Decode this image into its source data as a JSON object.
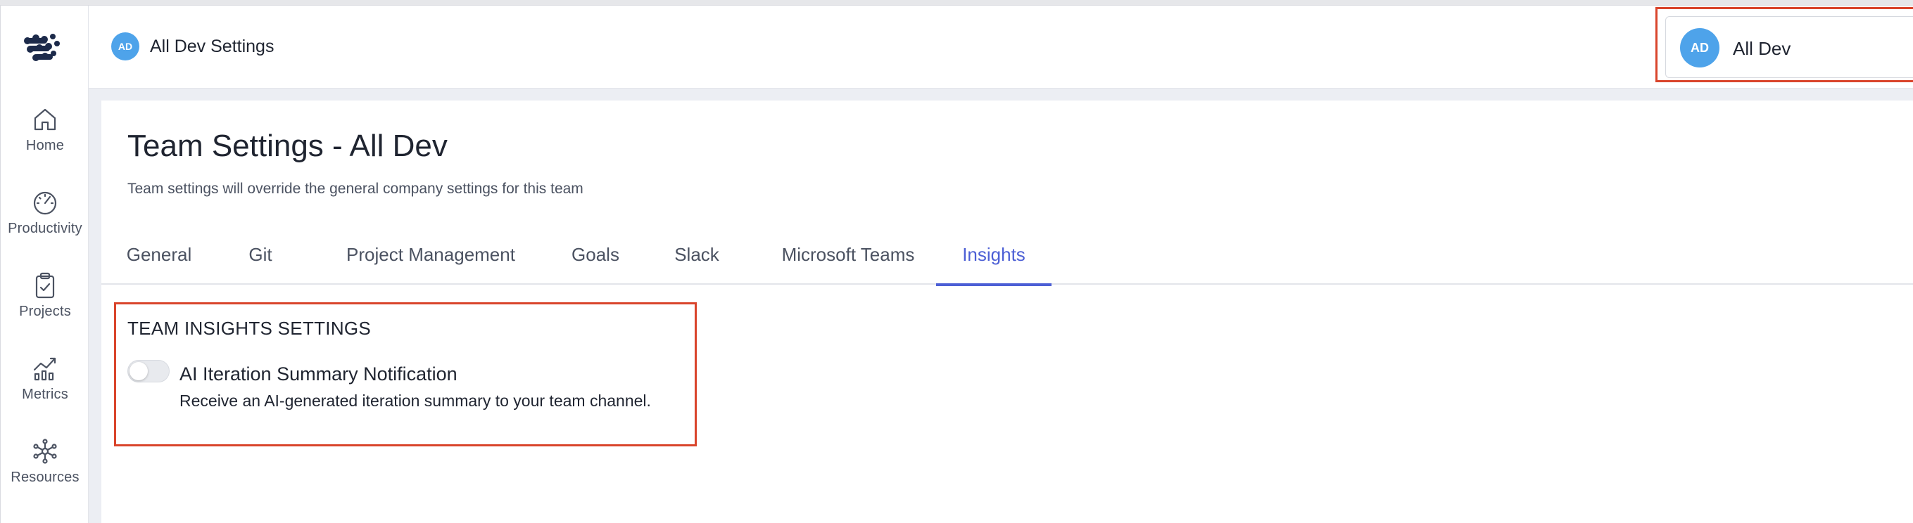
{
  "sidebar": {
    "items": [
      {
        "label": "Home",
        "icon": "home-icon"
      },
      {
        "label": "Productivity",
        "icon": "gauge-icon"
      },
      {
        "label": "Projects",
        "icon": "clipboard-icon"
      },
      {
        "label": "Metrics",
        "icon": "chart-icon"
      },
      {
        "label": "Resources",
        "icon": "network-icon"
      }
    ]
  },
  "header": {
    "avatar_initials": "AD",
    "title": "All Dev Settings",
    "team_selector": {
      "avatar_initials": "AD",
      "value": "All Dev"
    }
  },
  "main": {
    "title": "Team Settings - All Dev",
    "subtitle": "Team settings will override the general company settings for this team",
    "tabs": [
      {
        "label": "General"
      },
      {
        "label": "Git"
      },
      {
        "label": "Project Management"
      },
      {
        "label": "Goals"
      },
      {
        "label": "Slack"
      },
      {
        "label": "Microsoft Teams"
      },
      {
        "label": "Insights"
      }
    ],
    "active_tab": "Insights",
    "section": {
      "title": "TEAM INSIGHTS SETTINGS",
      "setting": {
        "title": "AI Iteration Summary Notification",
        "description": "Receive an AI-generated iteration summary to your team channel.",
        "enabled": false
      }
    }
  },
  "colors": {
    "accent": "#4c5fd5",
    "avatar": "#4ea3ea",
    "highlight": "#d9442b",
    "brand": "#1c2a4a"
  }
}
